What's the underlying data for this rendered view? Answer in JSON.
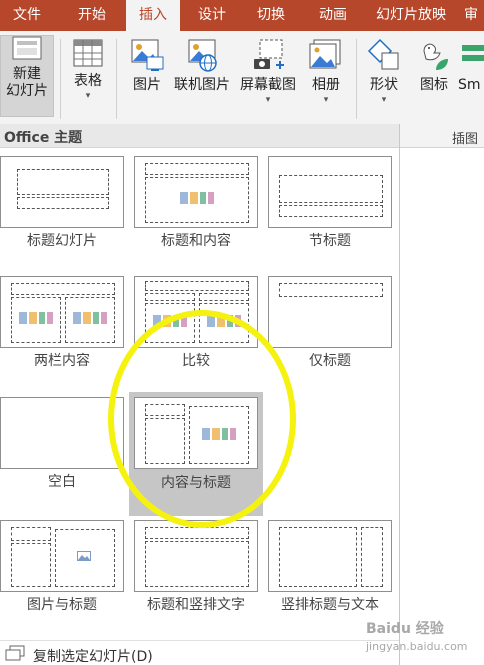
{
  "tabs": [
    {
      "label": "文件"
    },
    {
      "label": "开始"
    },
    {
      "label": "插入"
    },
    {
      "label": "设计"
    },
    {
      "label": "切换"
    },
    {
      "label": "动画"
    },
    {
      "label": "幻灯片放映"
    },
    {
      "label": "审"
    }
  ],
  "ribbon": {
    "new_slide_line1": "新建",
    "new_slide_line2": "幻灯片",
    "table": "表格",
    "picture": "图片",
    "online_picture": "联机图片",
    "screenshot": "屏幕截图",
    "album": "相册",
    "shapes": "形状",
    "icons": "图标",
    "smartart": "Sm",
    "group_illustrations": "插图"
  },
  "gallery": {
    "header": "Office 主题",
    "layouts": [
      {
        "label": "标题幻灯片"
      },
      {
        "label": "标题和内容"
      },
      {
        "label": "节标题"
      },
      {
        "label": "两栏内容"
      },
      {
        "label": "比较"
      },
      {
        "label": "仅标题"
      },
      {
        "label": "空白"
      },
      {
        "label": "内容与标题"
      },
      {
        "label": "图片与标题"
      },
      {
        "label": "标题和竖排文字"
      },
      {
        "label": "竖排标题与文本"
      }
    ],
    "selected_index": 7,
    "duplicate_slide": "复制选定幻灯片(D)"
  },
  "watermark": {
    "brand": "Baidu 经验",
    "sub": "jingyan.baidu.com"
  },
  "colors": {
    "accent": "#b7472a",
    "highlight": "#f5f20f"
  }
}
